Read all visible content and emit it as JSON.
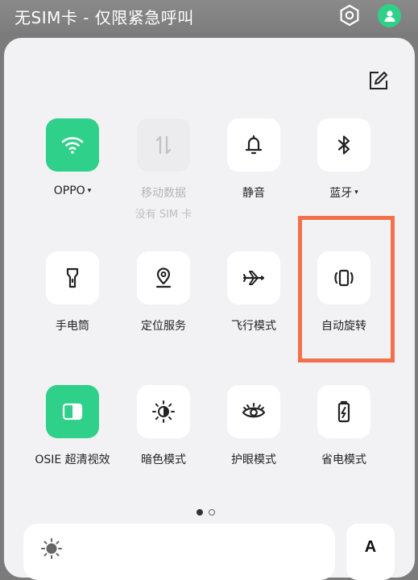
{
  "status_bar": {
    "text": "无SIM卡 - 仅限紧急呼叫"
  },
  "tiles": [
    {
      "label": "OPPO",
      "has_caret": true,
      "active": true,
      "icon": "wifi-icon"
    },
    {
      "label": "移动数据",
      "sub": "没有 SIM 卡",
      "disabled": true,
      "icon": "mobile-data-icon"
    },
    {
      "label": "静音",
      "icon": "bell-icon"
    },
    {
      "label": "蓝牙",
      "has_caret": true,
      "icon": "bluetooth-icon"
    },
    {
      "label": "手电筒",
      "icon": "flashlight-icon"
    },
    {
      "label": "定位服务",
      "icon": "location-icon"
    },
    {
      "label": "飞行模式",
      "icon": "airplane-icon"
    },
    {
      "label": "自动旋转",
      "icon": "auto-rotate-icon"
    },
    {
      "label": "OSIE 超清视效",
      "active": true,
      "icon": "osie-icon"
    },
    {
      "label": "暗色模式",
      "icon": "dark-mode-icon"
    },
    {
      "label": "护眼模式",
      "icon": "eye-icon"
    },
    {
      "label": "省电模式",
      "icon": "battery-saver-icon"
    }
  ],
  "caret_glyph": "▾",
  "font_size_button": {
    "label": "A"
  },
  "pagination": {
    "current": 1,
    "total": 2
  },
  "colors": {
    "accent": "#2fd08a",
    "highlight": "#f3704b"
  }
}
